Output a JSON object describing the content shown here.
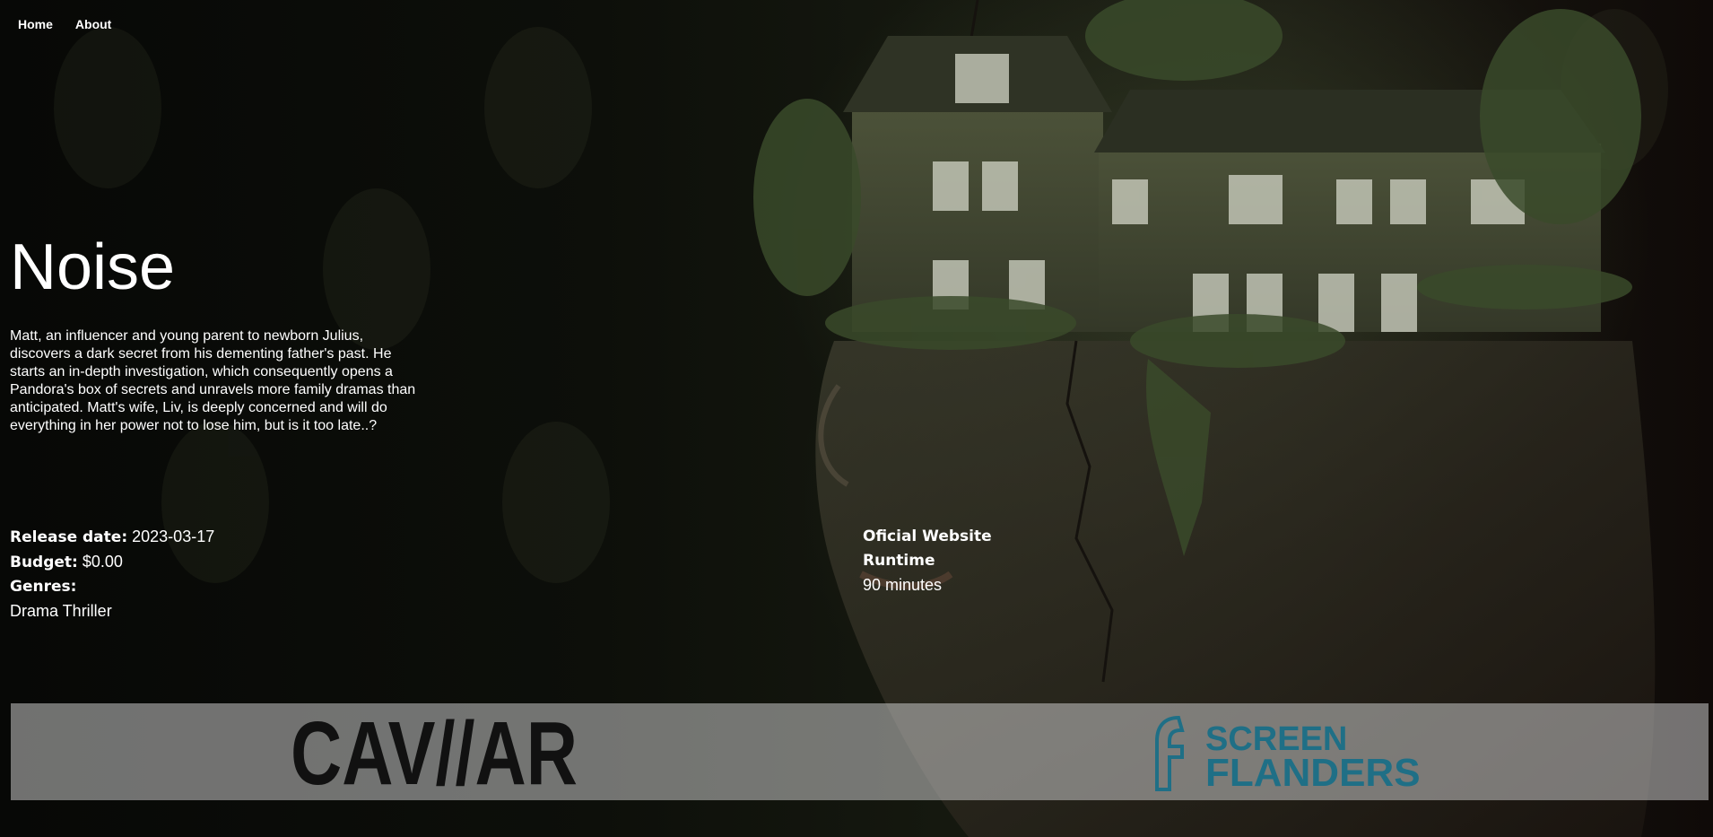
{
  "nav": {
    "items": [
      {
        "label": "Home"
      },
      {
        "label": "About"
      }
    ]
  },
  "movie": {
    "title": "Noise",
    "overview": "Matt, an influencer and young parent to newborn Julius, discovers a dark secret from his dementing father's past. He starts an in-depth investigation, which consequently opens a Pandora's box of secrets and unravels more family dramas than anticipated. Matt's wife, Liv, is deeply concerned and will do everything in her power not to lose him, but is it too late..?",
    "release_label": "Release date:",
    "release_date": "2023-03-17",
    "budget_label": "Budget:",
    "budget": "$0.00",
    "genres_label": "Genres:",
    "genres": "Drama Thriller",
    "website_label": "Oficial Website",
    "runtime_label": "Runtime",
    "runtime": "90 minutes"
  },
  "companies": [
    {
      "name": "CAVIAR",
      "logo_text": "CAV//AR",
      "color": "#111111"
    },
    {
      "name": "Screen Flanders",
      "logo_text_1": "SCREEN",
      "logo_text_2": "FLANDERS",
      "color": "#1f6f86"
    }
  ]
}
